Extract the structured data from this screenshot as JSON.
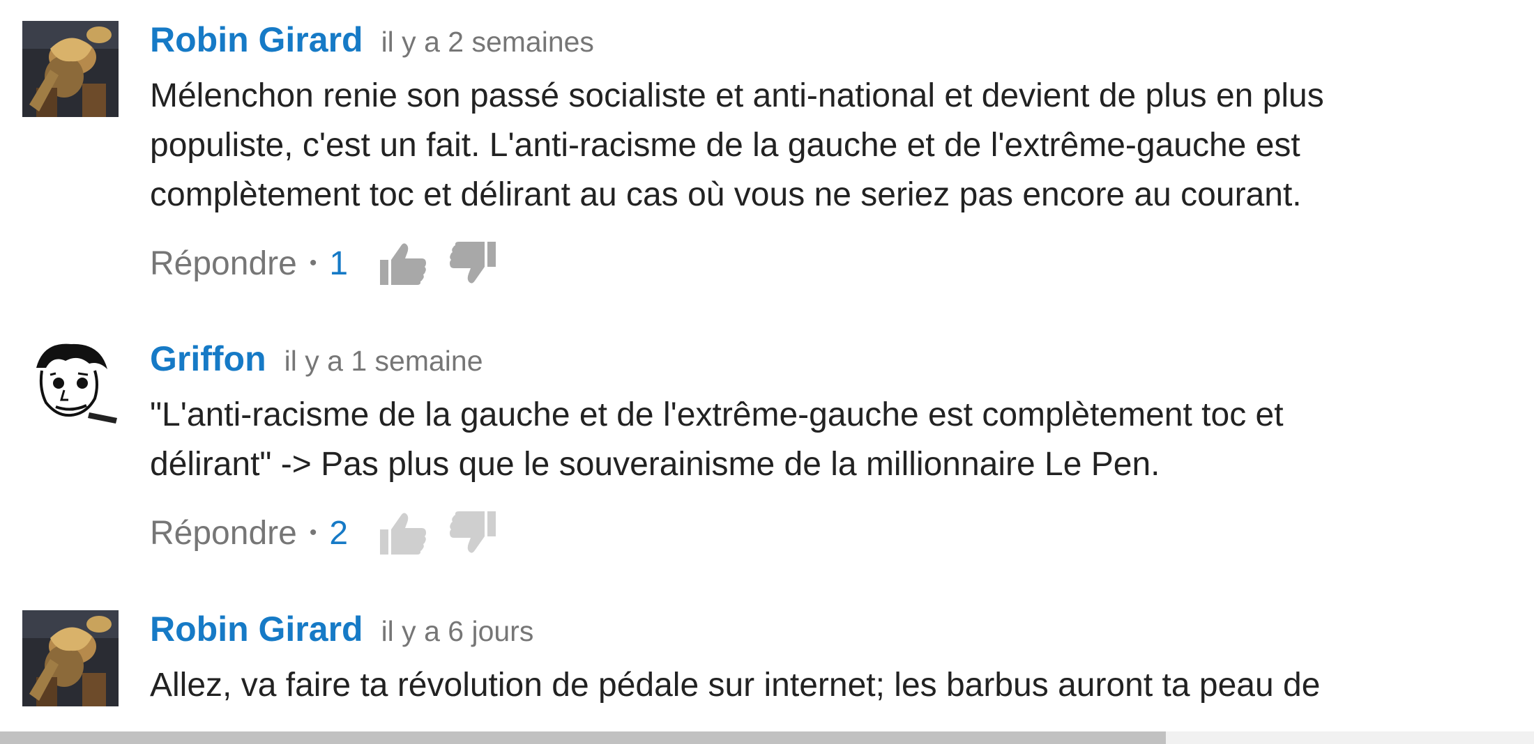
{
  "comments": [
    {
      "author": "Robin Girard",
      "time": "il y a 2 semaines",
      "text": "Mélenchon renie son passé socialiste et anti-national et devient de plus en plus\npopuliste, c'est un fait. L'anti-racisme de la gauche et de l'extrême-gauche est\ncomplètement toc et délirant au cas où vous ne seriez pas encore au courant.",
      "reply_label": "Répondre",
      "separator": "•",
      "likes": "1",
      "avatar_icon": "knight-avatar-icon"
    },
    {
      "author": "Griffon",
      "time": "il y a 1 semaine",
      "text": "\"L'anti-racisme de la gauche et de l'extrême-gauche est complètement toc et\ndélirant\" -> Pas plus que le souverainisme de la millionnaire Le Pen.",
      "reply_label": "Répondre",
      "separator": "•",
      "likes": "2",
      "avatar_icon": "sketch-face-avatar-icon"
    },
    {
      "author": "Robin Girard",
      "time": "il y a 6 jours",
      "text": "Allez, va faire ta révolution de pédale sur internet; les barbus auront ta peau de",
      "avatar_icon": "knight-avatar-icon"
    }
  ],
  "colors": {
    "author": "#167ac6",
    "timestamp": "#767676",
    "body": "#222222",
    "like_count": "#167ac6",
    "thumb_icon": "#a8a8a8"
  },
  "scrollbar": {
    "horizontal_position_fraction": 0.76
  }
}
